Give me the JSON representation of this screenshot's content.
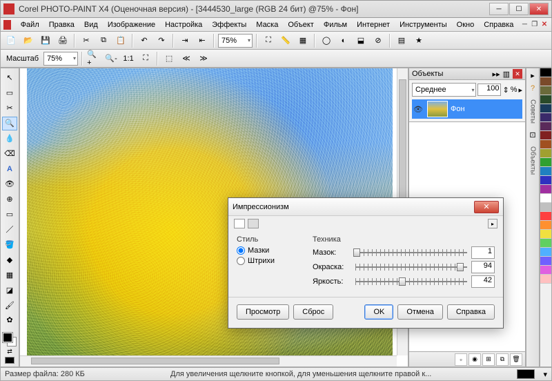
{
  "window": {
    "title": "Corel PHOTO-PAINT X4 (Оценочная версия) - [3444530_large (RGB 24 бит) @75% - Фон]"
  },
  "menu": {
    "file": "Файл",
    "edit": "Правка",
    "view": "Вид",
    "image": "Изображение",
    "adjust": "Настройка",
    "effects": "Эффекты",
    "mask": "Маска",
    "object": "Объект",
    "movie": "Фильм",
    "internet": "Интернет",
    "tools": "Инструменты",
    "window": "Окно",
    "help": "Справка"
  },
  "toolbar1": {
    "zoom_combo": "75%"
  },
  "toolbar2": {
    "scale_label": "Масштаб",
    "scale_value": "75%"
  },
  "objects_panel": {
    "title": "Объекты",
    "blend_mode": "Среднее",
    "opacity": "100",
    "percent": "%",
    "layer_name": "Фон"
  },
  "side_tabs": {
    "hints": "Советы",
    "objects": "Объекты"
  },
  "palette_colors": [
    "#000000",
    "#7a4a2a",
    "#6a6a3a",
    "#2a4a2a",
    "#1a3a5a",
    "#3a2a6a",
    "#5a2a5a",
    "#802020",
    "#a05020",
    "#a0a030",
    "#30a030",
    "#2080c0",
    "#3030c0",
    "#a030a0",
    "#ffffff",
    "#c0c0c0",
    "#ff4040",
    "#ff9030",
    "#f0e040",
    "#60d060",
    "#50b0ff",
    "#7060ff",
    "#e060e0",
    "#ffc0c0"
  ],
  "status": {
    "filesize_label": "Размер файла:",
    "filesize_value": "280 КБ",
    "hint": "Для увеличения щелкните кнопкой, для уменьшения щелкните правой к..."
  },
  "dialog": {
    "title": "Импрессионизм",
    "style_legend": "Стиль",
    "style_strokes": "Мазки",
    "style_hatches": "Штрихи",
    "tech_legend": "Техника",
    "stroke_label": "Мазок:",
    "stroke_value": "1",
    "stroke_pct": 1,
    "color_label": "Окраска:",
    "color_value": "94",
    "color_pct": 94,
    "bright_label": "Яркость:",
    "bright_value": "42",
    "bright_pct": 42,
    "btn_preview": "Просмотр",
    "btn_reset": "Сброс",
    "btn_ok": "OK",
    "btn_cancel": "Отмена",
    "btn_help": "Справка"
  }
}
